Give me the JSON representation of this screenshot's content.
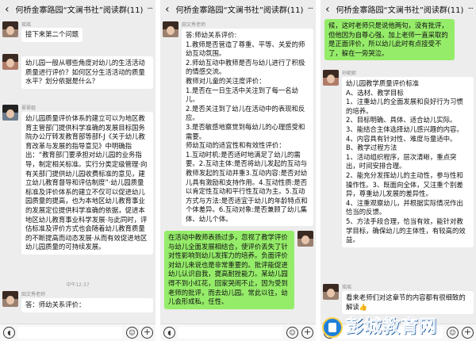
{
  "chat": {
    "title": "何桥金寨路园“文澜书社”阅读群(11)",
    "back": "‹",
    "more": "···"
  },
  "colors": {
    "self_bubble": "#95ec69",
    "other_bubble": "#ffffff",
    "background": "#ededed",
    "watermark": "#1a73d1"
  },
  "icons": {
    "voice": "voice-icon",
    "emoji": "emoji-icon",
    "plus": "plus-icon",
    "watermark": "watermark-logo-icon"
  },
  "panel1": {
    "m1": {
      "sender": "瑶瑶",
      "text": "接下来第二个问题"
    },
    "m2": {
      "sender": "",
      "text": "幼儿园一般从哪些角度对幼儿的生活活动质量进行评价？如何区分生活活动的质量水平？划分依据是什么？"
    },
    "m3": {
      "sender": "翠翠姐",
      "text": "幼儿园质量评价体系的建立可以为地区教育主管部门提供科学准确的发展目标国务院办公厅转发教育部等部f-J《关于幼儿教育改革与发展的指导意见》中明确指出：“教育部门要承担对幼儿园的业务指导，制定相关标准。实行分类定级管理·向有关部门提供幼儿园收费标准的意见，建立幼儿教育督导和评估制度”·幼儿园质量标准及评价体系的建立不仅可以促进幼儿园质量的提高，也为本地区幼儿教育事业的发展定位提供科学准确的依据，促进本地区幼儿教育事业科学发展·与此同时，评估标准及评价方式也会随着幼儿教育质量的不断提高而动态发展·从而有效促进地区幼儿园质量的可持续发展。"
    },
    "time": "中午12:37",
    "m4": {
      "sender": "田文秀老师",
      "text": "答：师幼关系评价："
    }
  },
  "panel2": {
    "m1": {
      "sender": "田文秀老师",
      "text": "答:师幼关系评价:\n1.教师是否营造了尊重、平等、关爱的师幼互动氛围。\n2.师幼互动中教师是否与幼儿进行了积极的情感交流。\n教师对儿童的关注度评价：\n1.是否在一日生活中关注到了每一名幼儿。\n2.是否关注到了幼儿在活动中的表现和反应。\n3.是否敏感地察觉到每幼儿的心理感受和需要。\n师幼互动的适宜性和有效性评价：\n1.互动时机:是否适时地满足了幼儿的需要。2.互动主体:是否将幼儿发起的互动与教师发起的互动并重3.互动内容:是否对幼儿具有激励和支持作用。4.互动性质:是否以肯定性互动和平行性互动为主。5.互动方式与方法:是否适宜于幼儿的年龄特点和个体差异。6.互动对象:是否兼顾了幼儿集体、幼儿个体。"
    },
    "m2": {
      "text": "在活动中教师表扬过多，忽视了教学评价与幼儿全面发展相结合，使评价丢失了针对性影响到幼儿发挥力的培养。负面评价对幼儿来说也是非常重要的。批评能促进幼儿认识自我，提高耐挫能力。某幼儿园得不到小红花，回家哭闹不止，因为受到老师的批评，而去幼儿园。常此以往，幼儿会形成私，任性、"
    }
  },
  "panel3": {
    "m1": {
      "text": "候，这时老师只是说他两句，没有批评，但他因为自尊心强，加上老师一直采取的是正面评价，所以幼儿此时有点接受不了，躲在一旁哭泣。"
    },
    "m2": {
      "sender": "孙妮妮",
      "text": "幼儿园教学质量评价标准\nA、选材、教学目标\n1、注重幼儿的全面发展和良好行为习惯的培养。\n2、目标明确、具体、适合幼儿实际。\n3、能结合主体选择幼儿感兴趣的内容。\n4、内容具有针对性、难度与量适中。\nB、教学过程方法\n1、活动组织程序，层次清晰，重点突出，时间安排合理。\n2、能充分发挥幼儿的主动性，参与性和操作性。3、既面向全体，又注重个别差异，尊重幼儿发展的差异性。\n4、注重观察幼儿，并根据实际情况作出恰当的反馈。\n5、方法手段合理，恰当有效，能针对教学目标，确保幼儿的主体性，有较高的效益。"
    },
    "m3": {
      "sender": "瑶瑶",
      "text": "看来老师们对这章节的内容都有很细致的解读👍"
    }
  },
  "watermark": {
    "text": "彭城教育网"
  }
}
